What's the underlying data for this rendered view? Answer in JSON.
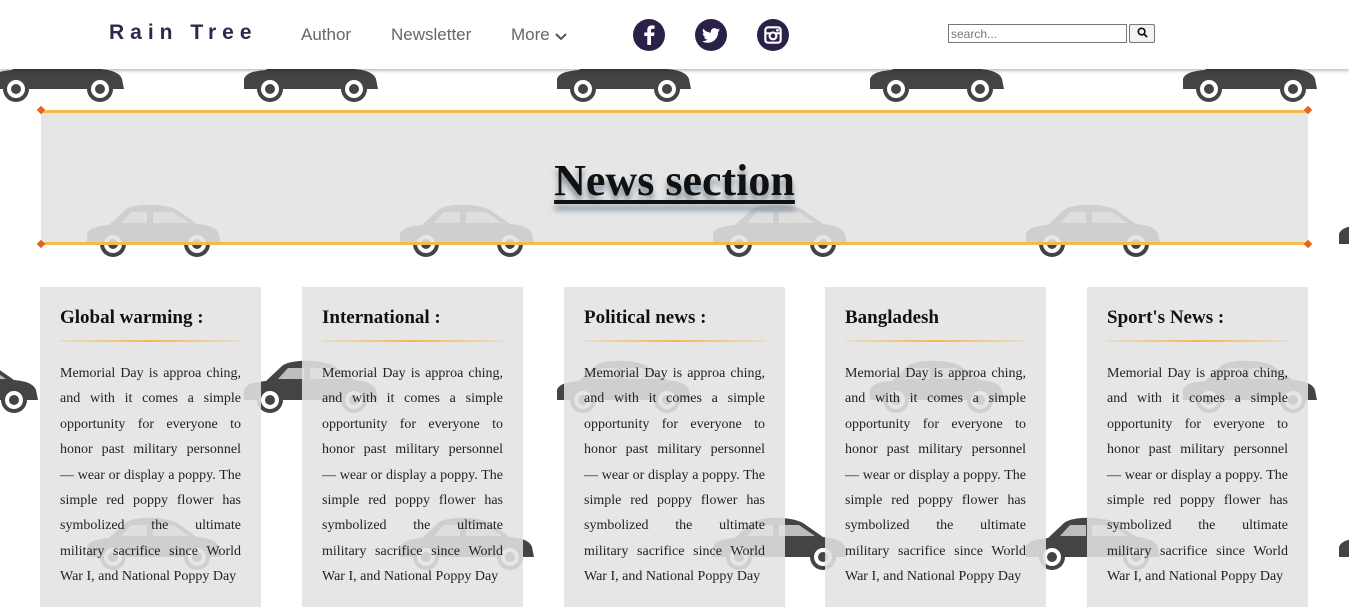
{
  "nav": {
    "brand": "Rain Tree",
    "links": [
      "Author",
      "Newsletter",
      "More"
    ],
    "social": [
      "facebook-icon",
      "twitter-icon",
      "instagram-icon"
    ],
    "search": {
      "placeholder": "search...",
      "button_icon": "search-icon"
    }
  },
  "hero": {
    "title": "News section"
  },
  "cards": [
    {
      "title": "Global warming :",
      "body": "Memorial Day is approa ching, and with it comes a simple opportunity for everyone to honor past military personnel — wear or display a poppy. The simple red poppy flower has symbolized the ultimate military sacrifice since World War I, and National Poppy Day"
    },
    {
      "title": "International :",
      "body": "Memorial Day is approa ching, and with it comes a simple opportunity for everyone to honor past military personnel — wear or display a poppy. The simple red poppy flower has symbolized the ultimate military sacrifice since World War I, and National Poppy Day"
    },
    {
      "title": "Political news :",
      "body": "Memorial Day is approa ching, and with it comes a simple opportunity for everyone to honor past military personnel — wear or display a poppy. The simple red poppy flower has symbolized the ultimate military sacrifice since World War I, and National Poppy Day"
    },
    {
      "title": "Bangladesh",
      "body": "Memorial Day is approa ching, and with it comes a simple opportunity for everyone to honor past military personnel — wear or display a poppy. The simple red poppy flower has symbolized the ultimate military sacrifice since World War I, and National Poppy Day"
    },
    {
      "title": "Sport's News :",
      "body": "Memorial Day is approa ching, and with it comes a simple opportunity for everyone to honor past military personnel — wear or display a poppy. The simple red poppy flower has symbolized the ultimate military sacrifice since World War I, and National Poppy Day"
    }
  ],
  "colors": {
    "brand": "#2e2a4f",
    "social_bg": "#2b2148",
    "accent_line": "#f6b84f",
    "accent_dot": "#e5631a",
    "panel_bg": "#e2e3e4",
    "car": "#444444"
  },
  "background": {
    "pattern_icon": "car-icon"
  }
}
